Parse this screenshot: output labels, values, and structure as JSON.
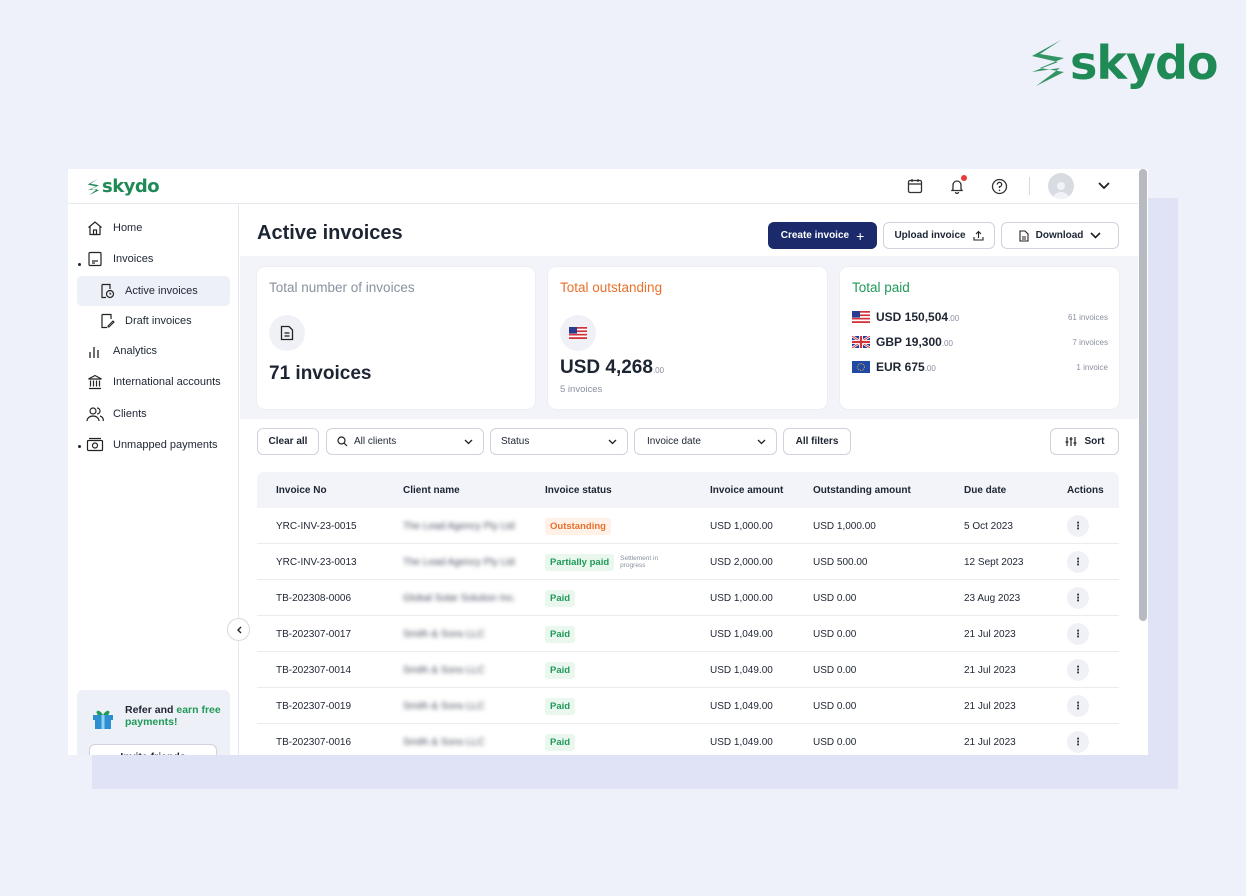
{
  "brand": {
    "name": "skydo"
  },
  "topbar": {
    "icons": [
      "calendar-icon",
      "bell-icon",
      "help-icon",
      "avatar",
      "chevron-down-icon"
    ]
  },
  "sidebar": {
    "items": [
      {
        "label": "Home",
        "icon": "home-icon"
      },
      {
        "label": "Invoices",
        "icon": "invoice-icon"
      },
      {
        "label": "Active invoices",
        "icon": "active-invoice-icon"
      },
      {
        "label": "Draft invoices",
        "icon": "draft-invoice-icon"
      },
      {
        "label": "Analytics",
        "icon": "analytics-icon"
      },
      {
        "label": "International accounts",
        "icon": "bank-icon"
      },
      {
        "label": "Clients",
        "icon": "clients-icon"
      },
      {
        "label": "Unmapped payments",
        "icon": "payments-icon"
      }
    ],
    "refer": {
      "text_a": "Refer and ",
      "text_b": "earn free payments!",
      "button": "Invite friends"
    }
  },
  "header": {
    "title": "Active invoices",
    "create_label": "Create invoice",
    "upload_label": "Upload invoice",
    "download_label": "Download"
  },
  "summary": {
    "total_count": {
      "title": "Total number of invoices",
      "value": "71 invoices"
    },
    "outstanding": {
      "title": "Total outstanding",
      "amount": "USD 4,268",
      "decimals": ".00",
      "note": "5 invoices"
    },
    "paid": {
      "title": "Total paid",
      "rows": [
        {
          "amount": "USD 150,504",
          "decimals": ".00",
          "count": "61 invoices"
        },
        {
          "amount": "GBP 19,300",
          "decimals": ".00",
          "count": "7 invoices"
        },
        {
          "amount": "EUR 675",
          "decimals": ".00",
          "count": "1 invoice"
        }
      ]
    }
  },
  "filters": {
    "clear": "Clear all",
    "clients": "All clients",
    "status": "Status",
    "date": "Invoice date",
    "all": "All filters",
    "sort": "Sort"
  },
  "table": {
    "headers": [
      "Invoice No",
      "Client name",
      "Invoice status",
      "Invoice amount",
      "Outstanding amount",
      "Due date",
      "Actions"
    ],
    "rows": [
      {
        "no": "YRC-INV-23-0015",
        "client": "The Lead Agency Pty Ltd",
        "status": "Outstanding",
        "amount": "USD 1,000.00",
        "outstanding": "USD 1,000.00",
        "due": "5 Oct 2023"
      },
      {
        "no": "YRC-INV-23-0013",
        "client": "The Lead Agency Pty Ltd",
        "status": "Partially paid",
        "note": "Settlement in progress",
        "amount": "USD 2,000.00",
        "outstanding": "USD 500.00",
        "due": "12 Sept 2023"
      },
      {
        "no": "TB-202308-0006",
        "client": "Global Solar Solution Inc.",
        "status": "Paid",
        "amount": "USD 1,000.00",
        "outstanding": "USD 0.00",
        "due": "23 Aug 2023"
      },
      {
        "no": "TB-202307-0017",
        "client": "Smith & Sons LLC",
        "status": "Paid",
        "amount": "USD 1,049.00",
        "outstanding": "USD 0.00",
        "due": "21 Jul 2023"
      },
      {
        "no": "TB-202307-0014",
        "client": "Smith & Sons LLC",
        "status": "Paid",
        "amount": "USD 1,049.00",
        "outstanding": "USD 0.00",
        "due": "21 Jul 2023"
      },
      {
        "no": "TB-202307-0019",
        "client": "Smith & Sons LLC",
        "status": "Paid",
        "amount": "USD 1,049.00",
        "outstanding": "USD 0.00",
        "due": "21 Jul 2023"
      },
      {
        "no": "TB-202307-0016",
        "client": "Smith & Sons LLC",
        "status": "Paid",
        "amount": "USD 1,049.00",
        "outstanding": "USD 0.00",
        "due": "21 Jul 2023"
      }
    ]
  },
  "colors": {
    "brand": "#1f8a55",
    "primary": "#1b2a6b",
    "outstanding": "#e8712c",
    "paid": "#1f9a58"
  }
}
